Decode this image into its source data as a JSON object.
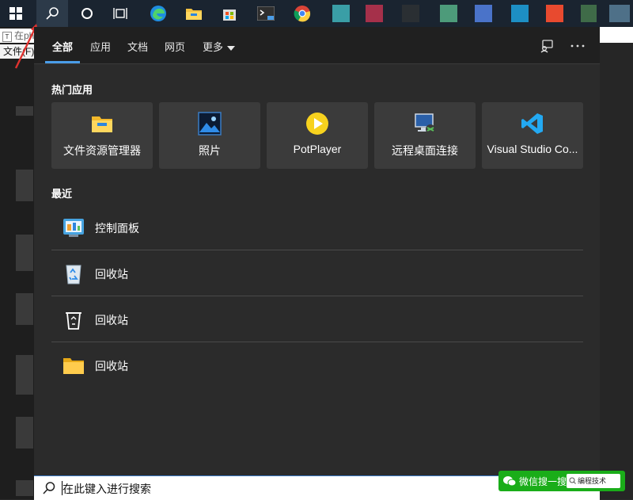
{
  "background_app": {
    "address_text": "在ph",
    "menu_text": "文件(F)"
  },
  "tabs": [
    {
      "label": "全部"
    },
    {
      "label": "应用"
    },
    {
      "label": "文档"
    },
    {
      "label": "网页"
    },
    {
      "label": "更多"
    }
  ],
  "top_apps": {
    "title": "热门应用",
    "items": [
      {
        "label": "文件资源管理器",
        "icon": "folder-icon"
      },
      {
        "label": "照片",
        "icon": "photos-icon"
      },
      {
        "label": "PotPlayer",
        "icon": "potplayer-icon"
      },
      {
        "label": "远程桌面连接",
        "icon": "remote-desktop-icon"
      },
      {
        "label": "Visual Studio Co...",
        "icon": "vscode-icon"
      }
    ]
  },
  "recent": {
    "title": "最近",
    "items": [
      {
        "label": "控制面板",
        "icon": "control-panel-icon"
      },
      {
        "label": "回收站",
        "icon": "recycle-bin-full-icon"
      },
      {
        "label": "回收站",
        "icon": "recycle-bin-empty-icon"
      },
      {
        "label": "回收站",
        "icon": "folder-icon"
      }
    ]
  },
  "search": {
    "placeholder": "在此键入进行搜索"
  },
  "watermark": {
    "text": "微信搜一搜",
    "box_text": "编程技术"
  },
  "colors": {
    "accent": "#4a9de8",
    "panel": "#2b2b2b",
    "tile": "#3b3b3b",
    "taskbar": "#1a2430"
  }
}
